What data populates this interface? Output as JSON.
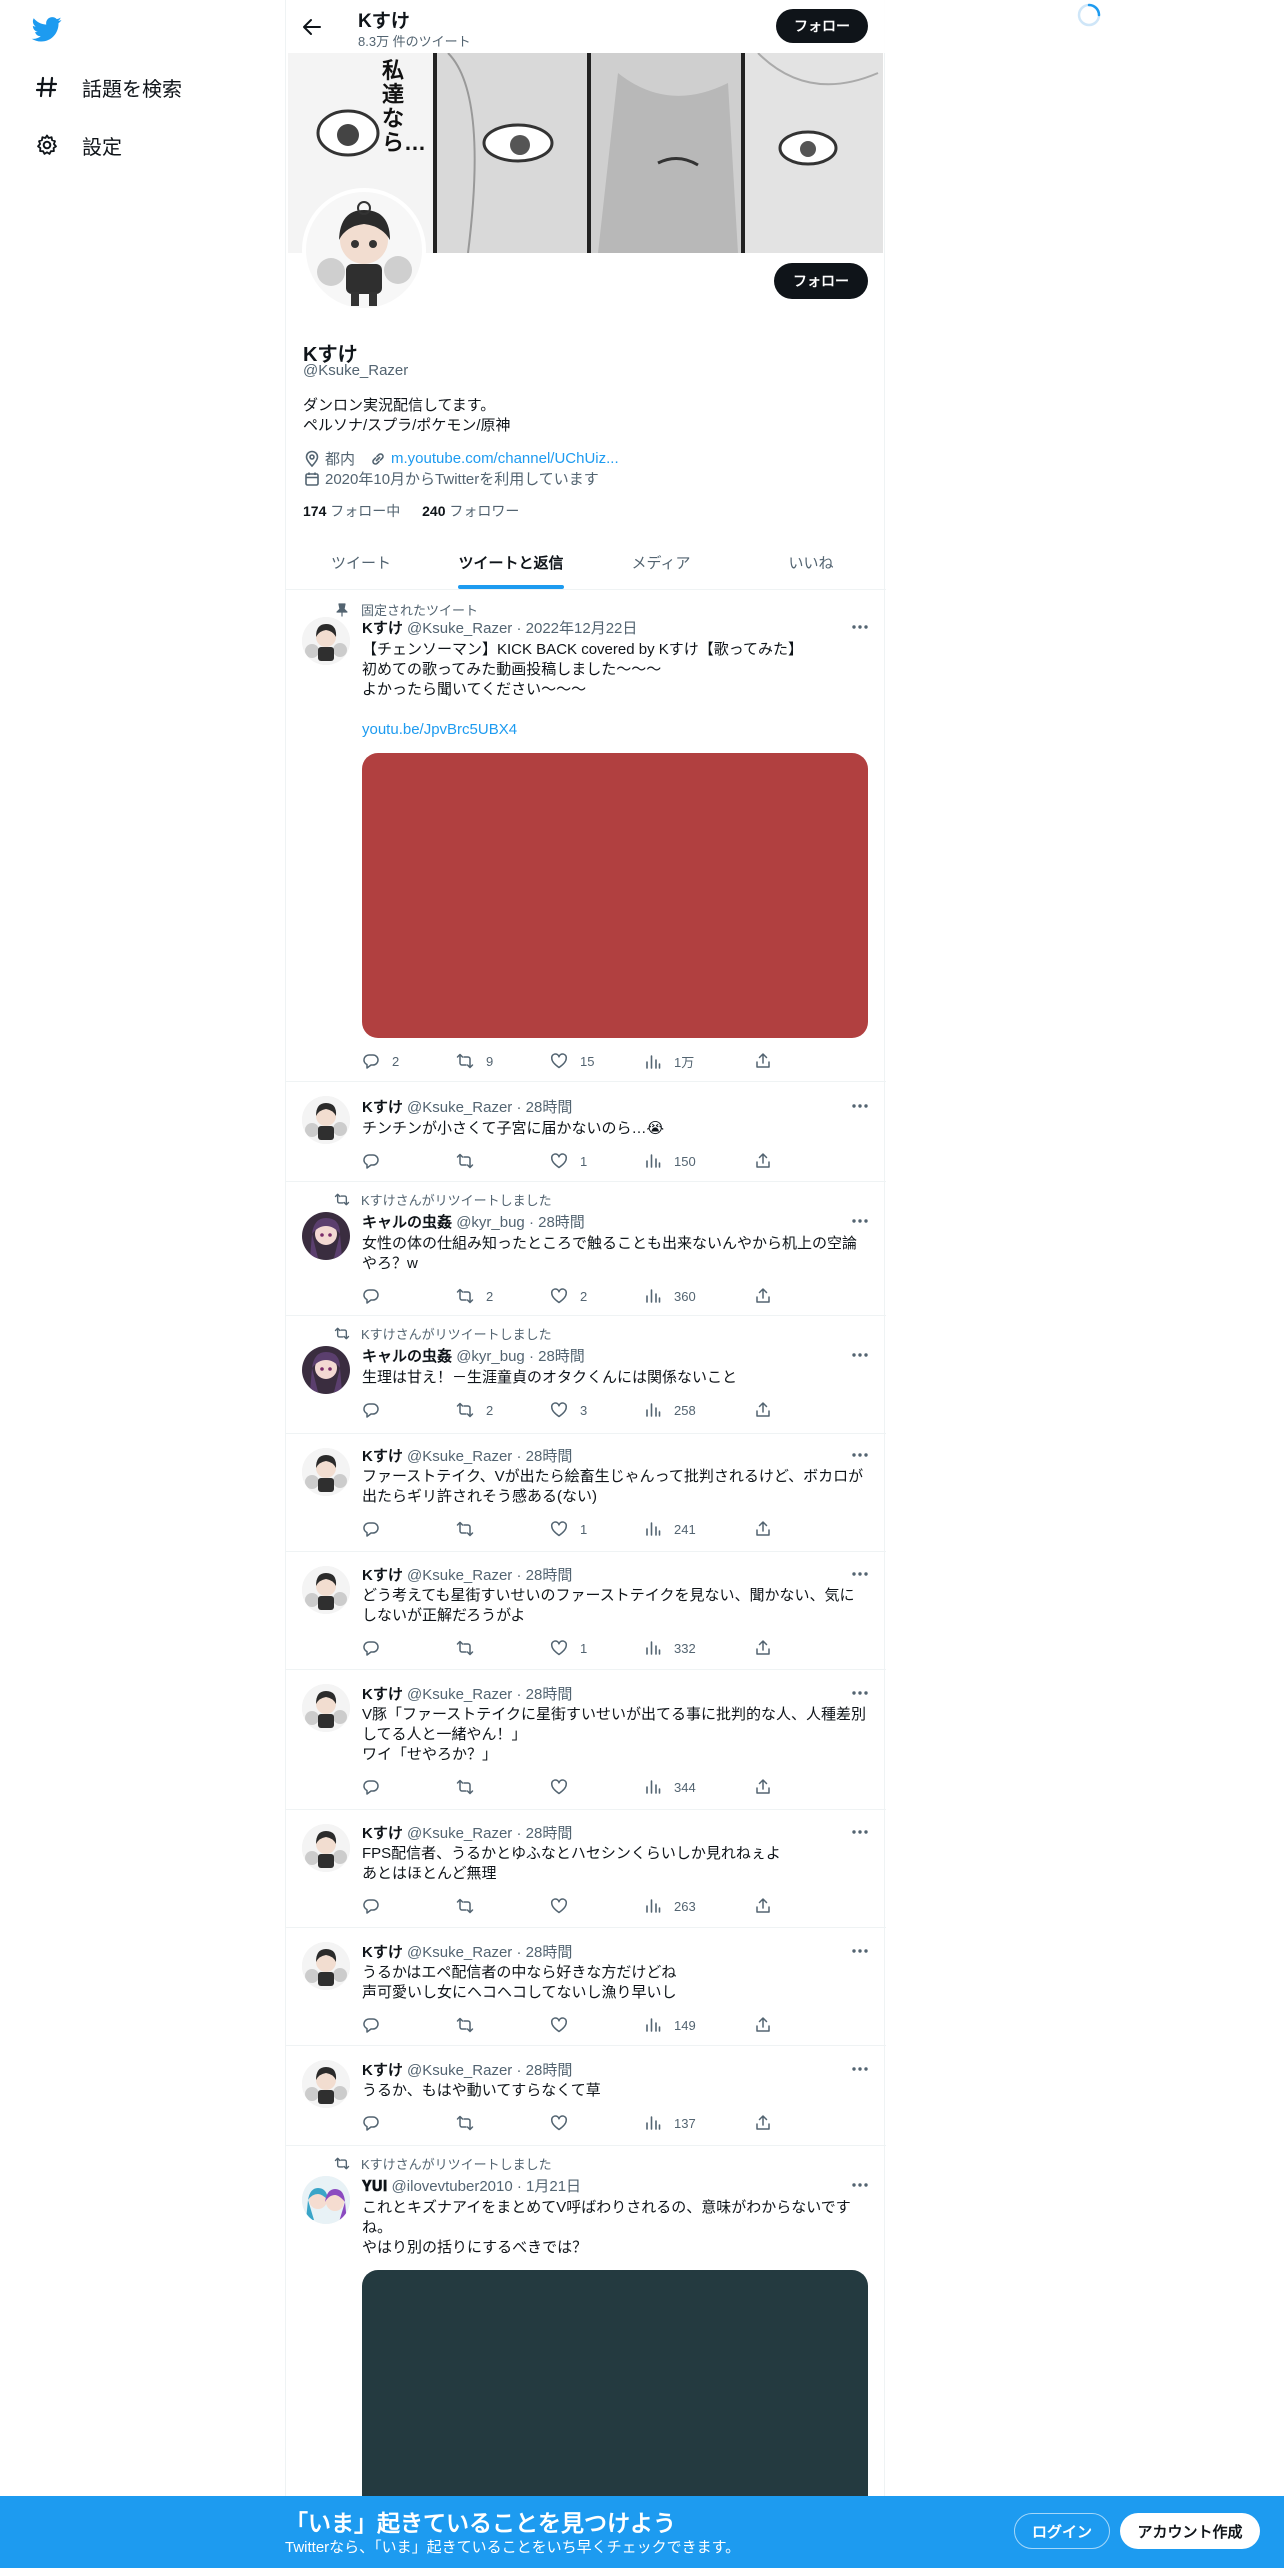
{
  "nav": {
    "items": [
      {
        "label": "話題を検索",
        "icon": "hashtag-icon"
      },
      {
        "label": "設定",
        "icon": "gear-icon"
      }
    ]
  },
  "header": {
    "name": "Kすけ",
    "tweet_count": "8.3万 件のツイート",
    "follow_label": "フォロー"
  },
  "profile": {
    "name": "Kすけ",
    "handle": "@Ksuke_Razer",
    "bio_line1": "ダンロン実況配信してます。",
    "bio_line2": "ペルソナ/スプラ/ポケモン/原神",
    "location": "都内",
    "url": "m.youtube.com/channel/UChUiz...",
    "joined": "2020年10月からTwitterを利用しています",
    "following_count": "174",
    "following_label": "フォロー中",
    "followers_count": "240",
    "followers_label": "フォロワー",
    "follow_label": "フォロー",
    "banner_text": "私達なら…"
  },
  "tabs": [
    {
      "label": "ツイート",
      "active": false
    },
    {
      "label": "ツイートと返信",
      "active": true
    },
    {
      "label": "メディア",
      "active": false
    },
    {
      "label": "いいね",
      "active": false
    }
  ],
  "tweets": [
    {
      "social": "固定されたツイート",
      "social_icon": "pin-icon",
      "name": "Kすけ",
      "handle": "@Ksuke_Razer",
      "time": "2022年12月22日",
      "lines": [
        "【チェンソーマン】KICK BACK covered by Kすけ【歌ってみた】",
        "初めての歌ってみた動画投稿しました～～～",
        "よかったら聞いてください～～～"
      ],
      "link": "youtu.be/JpvBrc5UBX4",
      "media_color": "#b14040",
      "replies": "2",
      "retweets": "9",
      "likes": "15",
      "views": "1万"
    },
    {
      "name": "Kすけ",
      "handle": "@Ksuke_Razer",
      "time": "28時間",
      "lines": [
        "チンチンが小さくて子宮に届かないのら…😭"
      ],
      "replies": "",
      "retweets": "",
      "likes": "1",
      "views": "150"
    },
    {
      "social": "Kすけさんがリツイートしました",
      "social_icon": "retweet-icon",
      "name": "キャルの虫姦",
      "handle": "@kyr_bug",
      "time": "28時間",
      "lines": [
        "女性の体の仕組み知ったところで触ることも出来ないんやから机上の空論",
        "やろ？w"
      ],
      "replies": "",
      "retweets": "2",
      "likes": "2",
      "views": "360"
    },
    {
      "social": "Kすけさんがリツイートしました",
      "social_icon": "retweet-icon",
      "name": "キャルの虫姦",
      "handle": "@kyr_bug",
      "time": "28時間",
      "lines": [
        "生理は甘え！－生涯童貞のオタクくんには関係ないこと"
      ],
      "replies": "",
      "retweets": "2",
      "likes": "3",
      "views": "258"
    },
    {
      "name": "Kすけ",
      "handle": "@Ksuke_Razer",
      "time": "28時間",
      "lines": [
        "ファーストテイク、Vが出たら絵畜生じゃんって批判されるけど、ボカロが",
        "出たらギリ許されそう感ある(ない)"
      ],
      "replies": "",
      "retweets": "",
      "likes": "1",
      "views": "241"
    },
    {
      "name": "Kすけ",
      "handle": "@Ksuke_Razer",
      "time": "28時間",
      "lines": [
        "どう考えても星街すいせいのファーストテイクを見ない、聞かない、気に",
        "しないが正解だろうがよ"
      ],
      "replies": "",
      "retweets": "",
      "likes": "1",
      "views": "332"
    },
    {
      "name": "Kすけ",
      "handle": "@Ksuke_Razer",
      "time": "28時間",
      "lines": [
        "V豚「ファーストテイクに星街すいせいが出てる事に批判的な人、人種差別",
        "してる人と一緒やん！」",
        "ワイ「せやろか？」"
      ],
      "replies": "",
      "retweets": "",
      "likes": "",
      "views": "344"
    },
    {
      "name": "Kすけ",
      "handle": "@Ksuke_Razer",
      "time": "28時間",
      "lines": [
        "FPS配信者、うるかとゆふなとハセシンくらいしか見れねぇよ",
        "あとはほとんど無理"
      ],
      "replies": "",
      "retweets": "",
      "likes": "",
      "views": "263"
    },
    {
      "name": "Kすけ",
      "handle": "@Ksuke_Razer",
      "time": "28時間",
      "lines": [
        "うるかはエペ配信者の中なら好きな方だけどね",
        "声可愛いし女にヘコヘコしてないし漁り早いし"
      ],
      "replies": "",
      "retweets": "",
      "likes": "",
      "views": "149"
    },
    {
      "name": "Kすけ",
      "handle": "@Ksuke_Razer",
      "time": "28時間",
      "lines": [
        "うるか、もはや動いてすらなくて草"
      ],
      "replies": "",
      "retweets": "",
      "likes": "",
      "views": "137"
    },
    {
      "social": "Kすけさんがリツイートしました",
      "social_icon": "retweet-icon",
      "name": "𝐘𝐔𝐈",
      "handle": "@ilovevtuber2010",
      "time": "1月21日",
      "lines": [
        "これとキズナアイをまとめてV呼ばわりされるの、意味がわからないです",
        "ね。",
        "やはり別の括りにするべきでは？"
      ],
      "media_color": "#243a40"
    }
  ],
  "bottombar": {
    "title": "「いま」起きていることを見つけよう",
    "subtitle": "Twitterなら、「いま」起きていることをいち早くチェックできます。",
    "login": "ログイン",
    "signup": "アカウント作成"
  },
  "colors": {
    "accent": "#1d9bf0",
    "text": "#0f1419",
    "secondary": "#536471"
  }
}
